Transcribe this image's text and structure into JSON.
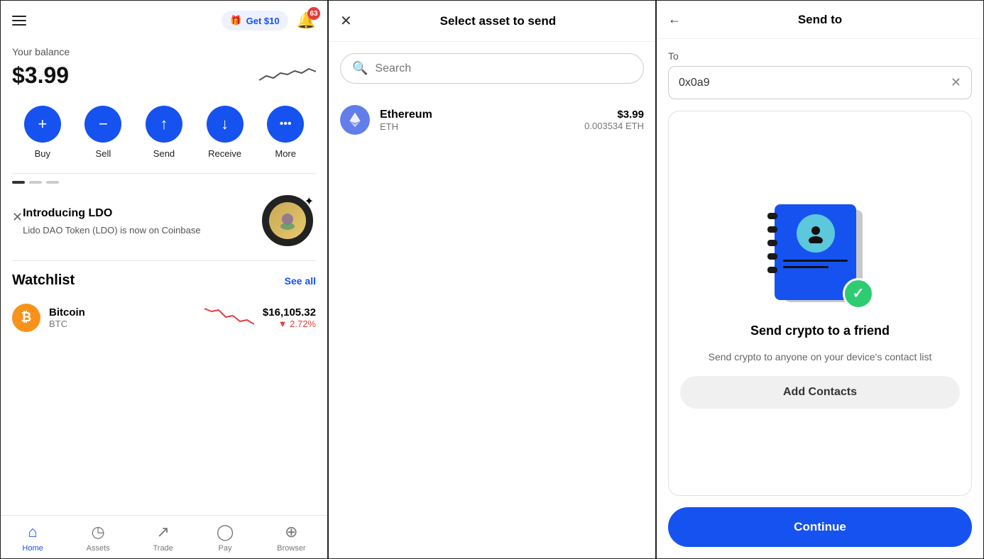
{
  "panel1": {
    "header": {
      "get_money_label": "Get $10",
      "notification_count": "63"
    },
    "balance": {
      "label": "Your balance",
      "amount": "$3.99"
    },
    "actions": [
      {
        "id": "buy",
        "label": "Buy",
        "icon": "+"
      },
      {
        "id": "sell",
        "label": "Sell",
        "icon": "−"
      },
      {
        "id": "send",
        "label": "Send",
        "icon": "↑"
      },
      {
        "id": "receive",
        "label": "Receive",
        "icon": "↓"
      },
      {
        "id": "more",
        "label": "More",
        "icon": "···"
      }
    ],
    "promo": {
      "title": "Introducing LDO",
      "description": "Lido DAO Token (LDO) is now on Coinbase"
    },
    "watchlist": {
      "title": "Watchlist",
      "see_all_label": "See all",
      "items": [
        {
          "name": "Bitcoin",
          "symbol": "BTC",
          "price": "$16,105.32",
          "change": "▼ 2.72%"
        }
      ]
    },
    "nav": [
      {
        "id": "home",
        "label": "Home",
        "active": true,
        "icon": "⌂"
      },
      {
        "id": "assets",
        "label": "Assets",
        "active": false,
        "icon": "⊙"
      },
      {
        "id": "trade",
        "label": "Trade",
        "active": false,
        "icon": "↗"
      },
      {
        "id": "pay",
        "label": "Pay",
        "active": false,
        "icon": "◯"
      },
      {
        "id": "browser",
        "label": "Browser",
        "active": false,
        "icon": "⊕"
      }
    ]
  },
  "panel2": {
    "title": "Select asset to send",
    "search_placeholder": "Search",
    "asset": {
      "name": "Ethereum",
      "symbol": "ETH",
      "usd": "$3.99",
      "crypto": "0.003534 ETH"
    }
  },
  "panel3": {
    "title": "Send to",
    "to_label": "To",
    "to_value": "0x0a9",
    "illustration": {
      "title": "Send crypto to a friend",
      "description": "Send crypto to anyone on your device's contact list"
    },
    "add_contacts_label": "Add Contacts",
    "continue_label": "Continue"
  }
}
